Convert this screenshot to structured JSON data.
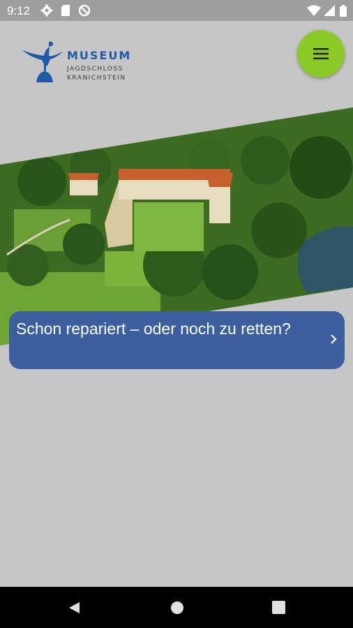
{
  "status_bar": {
    "time": "9:12",
    "icons": [
      "settings-gear-icon",
      "sd-card-icon",
      "data-saver-icon",
      "wifi-icon",
      "cell-signal-icon",
      "battery-icon"
    ]
  },
  "header": {
    "logo": {
      "name": "MUSEUM",
      "line1": "JAGDSCHLOSS",
      "line2": "KRANICHSTEIN",
      "color": "#1f5aa8"
    },
    "menu_button": {
      "icon": "hamburger-menu-icon",
      "color": "#8bc926"
    }
  },
  "hero": {
    "description_icon": "aerial-castle-photo"
  },
  "promo_card": {
    "title": "Schon repariert – oder noch zu retten?",
    "icon": "chevron-right-icon",
    "color": "#3b5f9f"
  },
  "nav_bar": {
    "buttons": [
      "back-icon",
      "home-icon",
      "recents-icon"
    ]
  }
}
